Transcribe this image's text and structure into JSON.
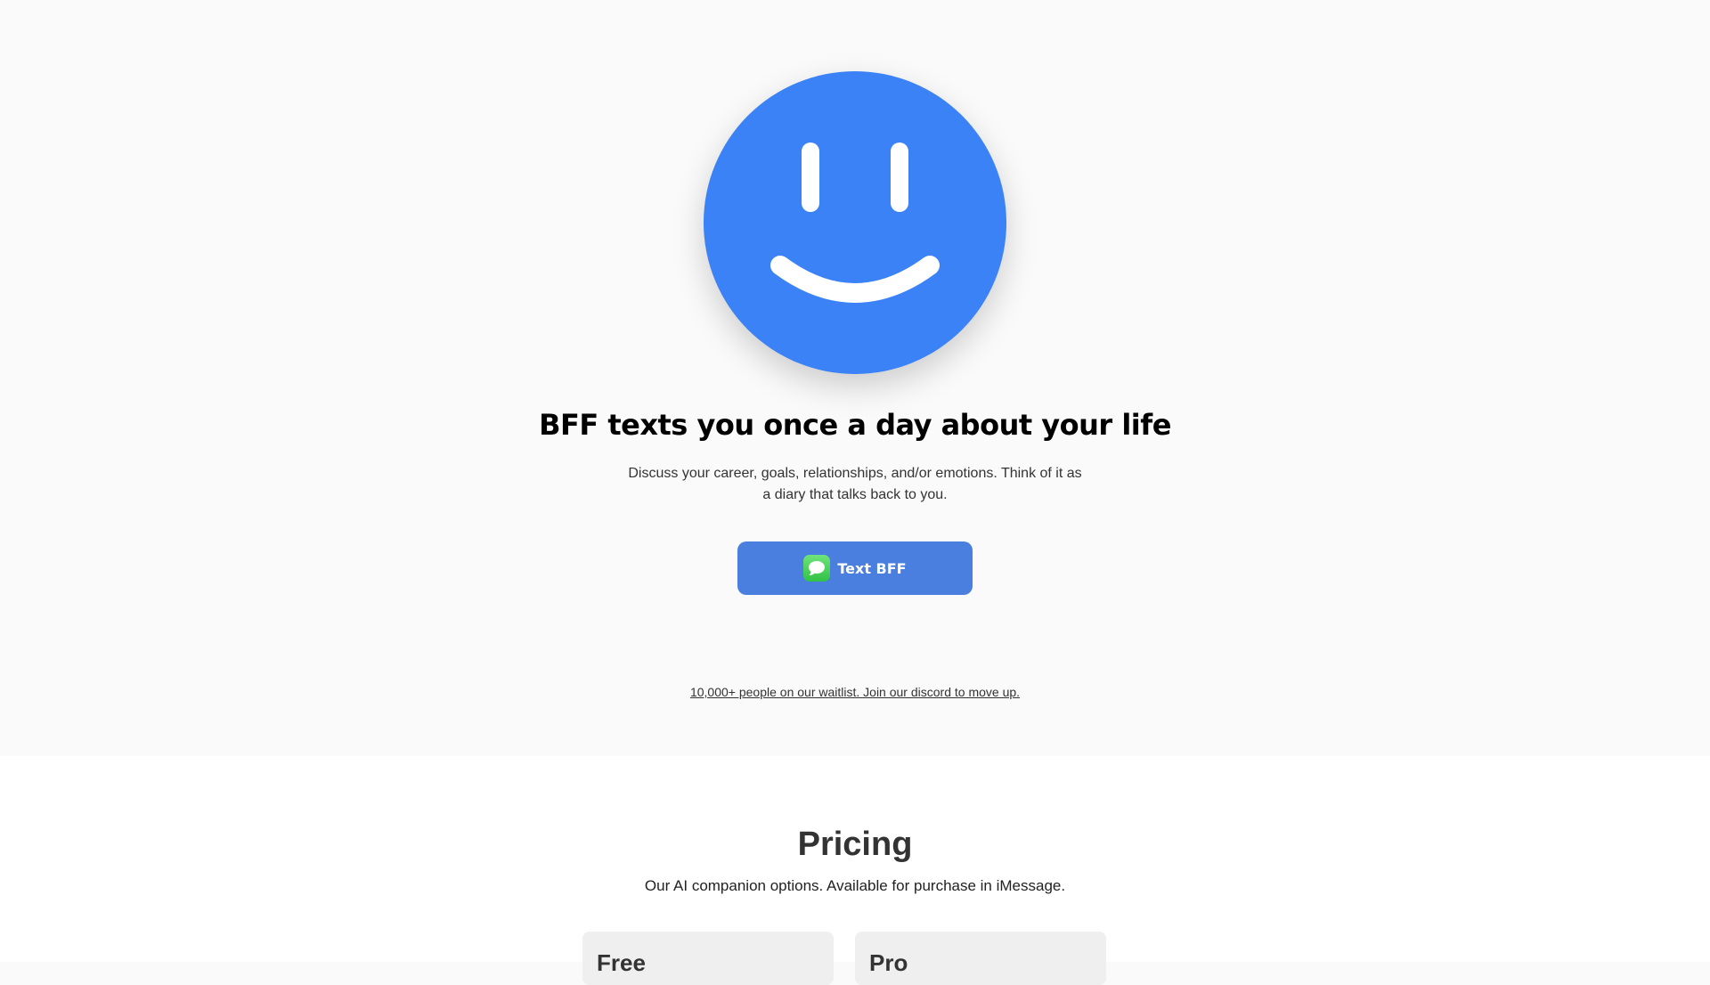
{
  "hero": {
    "logo_icon": "smiley-face-icon",
    "headline": "BFF texts you once a day about your life",
    "subtext": "Discuss your career, goals, relationships, and/or emotions. Think of it as a diary that talks back to you.",
    "cta": {
      "label": "Text BFF",
      "icon": "imessage-icon"
    },
    "waitlist_link": "10,000+ people on our waitlist. Join our discord to move up."
  },
  "pricing": {
    "title": "Pricing",
    "subtitle": "Our AI companion options. Available for purchase in iMessage.",
    "plans": [
      {
        "name": "Free"
      },
      {
        "name": "Pro"
      }
    ]
  },
  "colors": {
    "brand_blue": "#3b82f6",
    "button_blue": "#4a7fe0",
    "imessage_green": "#34c759",
    "hero_background": "#fafafa",
    "card_background": "#efefef"
  }
}
